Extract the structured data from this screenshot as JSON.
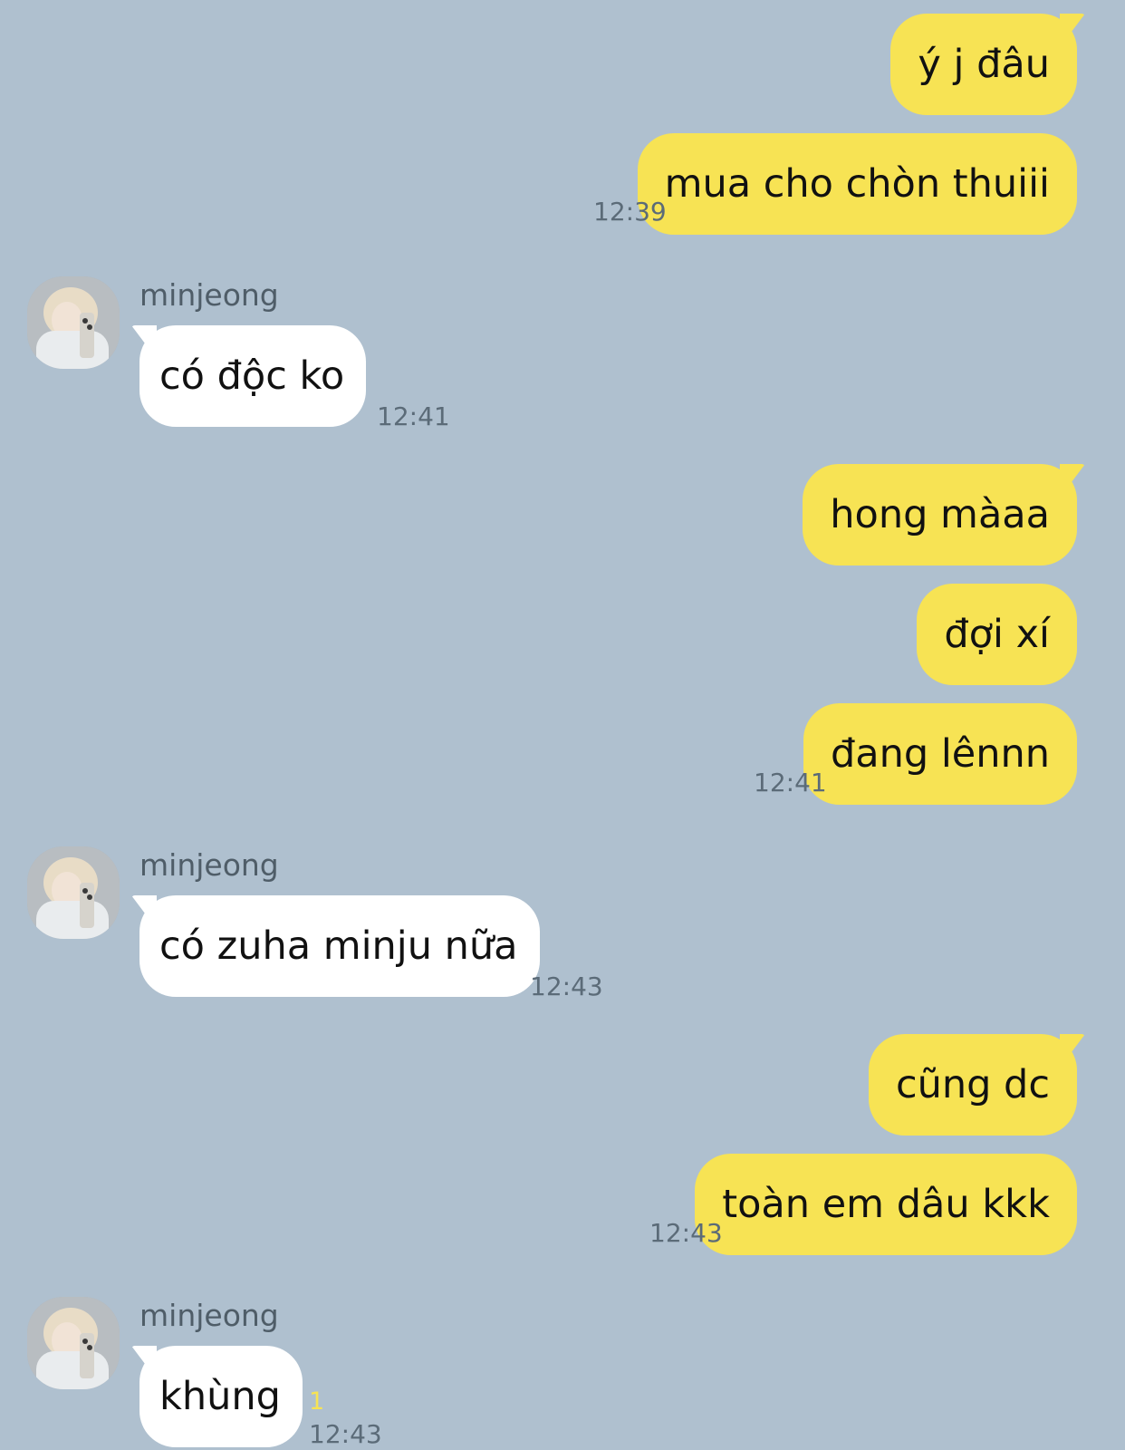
{
  "chat": {
    "contact_name": "minjeong",
    "messages": [
      {
        "side": "out",
        "text": "ý j đâu",
        "time": ""
      },
      {
        "side": "out",
        "text": "mua cho chòn thuiii",
        "time": "12:39"
      },
      {
        "side": "in",
        "sender": "minjeong",
        "text": "có độc ko",
        "time": "12:41"
      },
      {
        "side": "out",
        "text": "hong màaa",
        "time": ""
      },
      {
        "side": "out",
        "text": "đợi xí",
        "time": ""
      },
      {
        "side": "out",
        "text": "đang lênnn",
        "time": "12:41"
      },
      {
        "side": "in",
        "sender": "minjeong",
        "text": "có zuha minju nữa",
        "time": "12:43"
      },
      {
        "side": "out",
        "text": "cũng dc",
        "time": ""
      },
      {
        "side": "out",
        "text": "toàn em dâu kkk",
        "time": "12:43"
      },
      {
        "side": "in",
        "sender": "minjeong",
        "text": "khùng",
        "time": "12:43",
        "unread": "1"
      }
    ]
  },
  "colors": {
    "background": "#afc0cf",
    "outgoing_bubble": "#f7e354",
    "incoming_bubble": "#ffffff",
    "unread_count": "#f7e354"
  },
  "icons": {
    "avatar": "contact-avatar-photo"
  }
}
